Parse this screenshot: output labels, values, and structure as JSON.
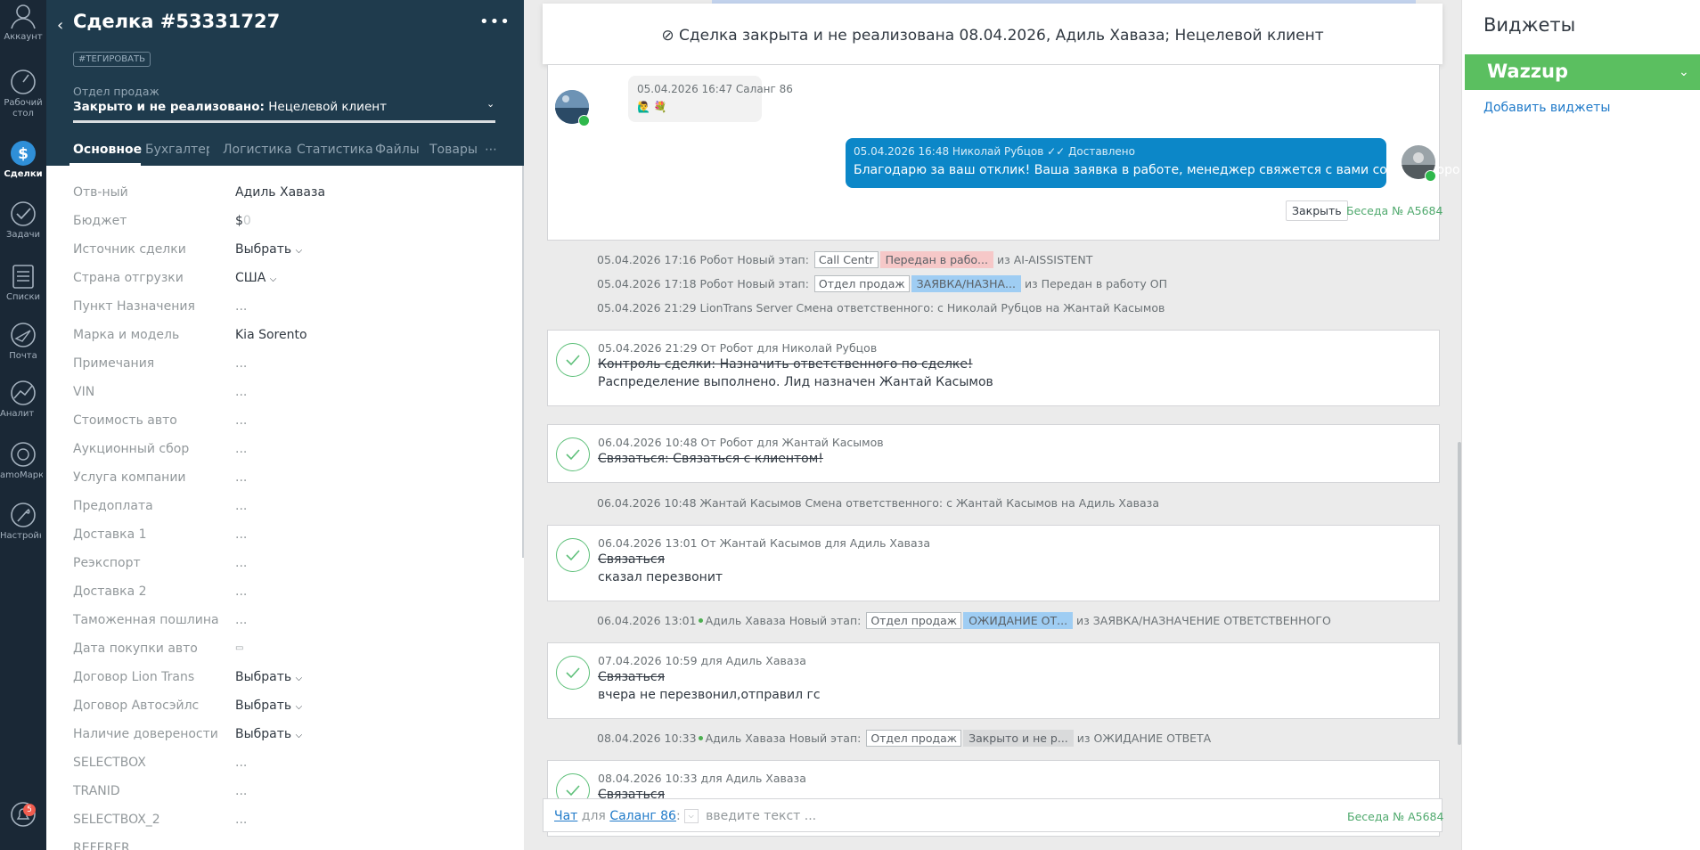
{
  "nav": {
    "items": [
      {
        "label": "Аккаунт",
        "icon": "account-icon"
      },
      {
        "label": "Рабочий стол",
        "icon": "dashboard-icon"
      },
      {
        "label": "Сделки",
        "icon": "deals-icon",
        "active": true
      },
      {
        "label": "Задачи",
        "icon": "tasks-icon"
      },
      {
        "label": "Списки",
        "icon": "lists-icon"
      },
      {
        "label": "Почта",
        "icon": "mail-icon"
      },
      {
        "label": "Аналитика",
        "icon": "analytics-icon"
      },
      {
        "label": "amoМаркет",
        "icon": "market-icon"
      },
      {
        "label": "Настройки",
        "icon": "settings-icon"
      }
    ],
    "notifications_count": "5"
  },
  "deal": {
    "title": "Сделка #53331727",
    "tag_button": "#ТЕГИРОВАТЬ",
    "pipeline_label": "Отдел продаж",
    "status_bold": "Закрыто и не реализовано:",
    "status_reason": "Нецелевой клиент",
    "tabs": [
      "Основное",
      "Бухгалтерия",
      "Логистика",
      "Статистика",
      "Файлы",
      "Товары"
    ],
    "budget_currency": "$",
    "budget_value": "0",
    "fields": [
      {
        "label": "Отв-ный",
        "value": "Адиль Хаваза"
      },
      {
        "label": "Бюджет",
        "value": ""
      },
      {
        "label": "Источник сделки",
        "value": "Выбрать"
      },
      {
        "label": "Страна отгрузки",
        "value": "США"
      },
      {
        "label": "Пункт Назначения",
        "value": "..."
      },
      {
        "label": "Марка и модель",
        "value": "Kia Sorento"
      },
      {
        "label": "Примечания",
        "value": "..."
      },
      {
        "label": "VIN",
        "value": "..."
      },
      {
        "label": "Стоимость авто",
        "value": "..."
      },
      {
        "label": "Аукционный сбор",
        "value": "..."
      },
      {
        "label": "Услуга компании",
        "value": "..."
      },
      {
        "label": "Предоплата",
        "value": "..."
      },
      {
        "label": "Доставка 1",
        "value": "..."
      },
      {
        "label": "Реэкспорт",
        "value": "..."
      },
      {
        "label": "Доставка 2",
        "value": "..."
      },
      {
        "label": "Таможенная пошлина",
        "value": "..."
      },
      {
        "label": "Дата покупки авто",
        "value": "▭"
      },
      {
        "label": "Договор Lion Trans",
        "value": "Выбрать"
      },
      {
        "label": "Договор Автосэйлс",
        "value": "Выбрать"
      },
      {
        "label": "Наличие доверености",
        "value": "Выбрать"
      },
      {
        "label": "SELECTBOX",
        "value": "..."
      },
      {
        "label": "TRANID",
        "value": "..."
      },
      {
        "label": "SELECTBOX_2",
        "value": "..."
      },
      {
        "label": "REFERER",
        "value": ""
      }
    ]
  },
  "feed": {
    "closed_banner": "Сделка закрыта и не реализована 08.04.2026, Адиль Хаваза; Нецелевой клиент",
    "chat": {
      "incoming_meta": "05.04.2026 16:47 Саланг 86",
      "incoming_emoji": "🙋‍♂️ 💐",
      "outgoing_meta": "05.04.2026 16:48 Николай Рубцов ✓✓ Доставлено",
      "outgoing_text": "Благодарю за ваш отклик! Ваша заявка в работе, менеджер свяжется с вами совсем скоро.",
      "close_button": "Закрыть",
      "conversation_id": "Беседа № А5684"
    },
    "events": [
      {
        "prefix": "05.04.2026 17:16 Робот Новый этап:",
        "pipeline": "Call Centr",
        "stage": "Передан в рабо...",
        "stage_color": "#f6c8c8",
        "suffix": "из AI-AISSISTENT"
      },
      {
        "prefix": "05.04.2026 17:18 Робот Новый этап:",
        "pipeline": "Отдел продаж",
        "stage": "ЗАЯВКА/НАЗНА...",
        "stage_color": "#9fcdf3",
        "suffix": "из Передан в работу ОП"
      },
      {
        "text": "05.04.2026 21:29 LionTrans Server Смена ответственного: с Николай Рубцов на Жантай Касымов"
      },
      {
        "text": "06.04.2026 10:48 Жантай Касымов Смена ответственного: с Жантай Касымов на Адиль Хаваза"
      },
      {
        "prefix": "06.04.2026 13:01",
        "actor": "Адиль Хаваза Новый этап:",
        "pipeline": "Отдел продаж",
        "stage": "ОЖИДАНИЕ ОТ...",
        "stage_color": "#9fcdf3",
        "suffix": "из ЗАЯВКА/НАЗНАЧЕНИЕ ОТВЕТСТВЕННОГО"
      },
      {
        "prefix": "08.04.2026 10:33",
        "actor": "Адиль Хаваза Новый этап:",
        "pipeline": "Отдел продаж",
        "stage": "Закрыто и не р...",
        "stage_color": "#d9dadb",
        "suffix": "из ОЖИДАНИЕ ОТВЕТА"
      }
    ],
    "tasks": [
      {
        "meta": "05.04.2026 21:29  От Робот для Николай Рубцов",
        "title": "Контроль сделки: Назначить ответственного по сделке!",
        "result": "Распределение выполнено. Лид назначен Жантай Касымов"
      },
      {
        "meta": "06.04.2026 10:48  От Робот для Жантай Касымов",
        "title": "Связаться: Связаться с клиентом!",
        "result": ""
      },
      {
        "meta": "06.04.2026 13:01  От Жантай Касымов для Адиль Хаваза",
        "title": "Связаться",
        "result": "сказал перезвонит"
      },
      {
        "meta": "07.04.2026 10:59  для Адиль Хаваза",
        "title": "Связаться",
        "result": "вчера не перезвонил,отправил гс"
      },
      {
        "meta": "08.04.2026 10:33  для Адиль Хаваза",
        "title": "Связаться",
        "result": ""
      }
    ],
    "composer": {
      "chat_link": "Чат",
      "for_word": "для",
      "recipient_link": "Саланг 86",
      "placeholder": "введите текст ...",
      "conversation_id": "Беседа № А5684"
    }
  },
  "widgets": {
    "title": "Виджеты",
    "wazzup_name": "Wazzup",
    "add_link": "Добавить виджеты"
  }
}
